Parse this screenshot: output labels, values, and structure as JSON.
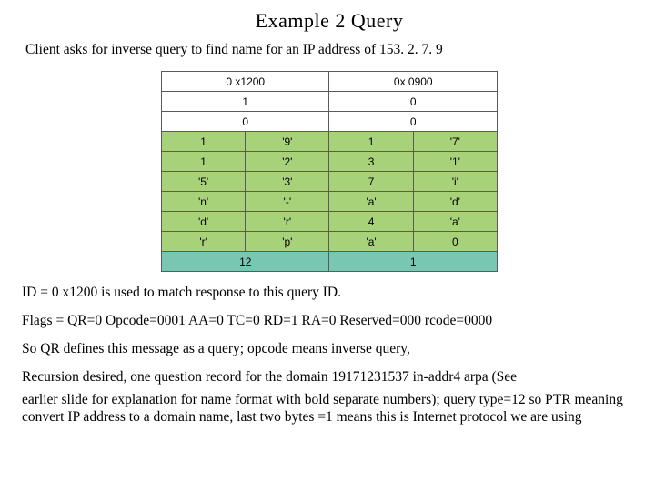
{
  "title": "Example 2 Query",
  "subtitle": "Client asks for inverse query to find name for an IP address of 153. 2. 7. 9",
  "table": {
    "r0": {
      "a": "0 x1200",
      "b": "0x 0900"
    },
    "r1": {
      "a": "1",
      "b": "0"
    },
    "r2": {
      "a": "0",
      "b": "0"
    },
    "r3": {
      "a": "1",
      "b": "'9'",
      "c": "1",
      "d": "'7'"
    },
    "r4": {
      "a": "1",
      "b": "'2'",
      "c": "3",
      "d": "'1'"
    },
    "r5": {
      "a": "'5'",
      "b": "'3'",
      "c": "7",
      "d": "'i'"
    },
    "r6": {
      "a": "'n'",
      "b": "'-'",
      "c": "'a'",
      "d": "'d'"
    },
    "r7": {
      "a": "'d'",
      "b": "'r'",
      "c": "4",
      "d": "'a'"
    },
    "r8": {
      "a": "'r'",
      "b": "'p'",
      "c": "'a'",
      "d": "0"
    },
    "r9": {
      "a": "12",
      "b": "1"
    }
  },
  "para": {
    "p1": "ID = 0 x1200 is used to match response to this query ID.",
    "p2": "Flags = QR=0 Opcode=0001 AA=0 TC=0 RD=1 RA=0 Reserved=000 rcode=0000",
    "p3": "So QR defines this message as a query; opcode means inverse query,",
    "p4": "Recursion desired, one question record for the domain 19171231537 in-addr4 arpa (See",
    "p5": "earlier slide for explanation for name format with bold separate numbers); query type=12 so PTR meaning convert IP address to a domain name, last two bytes =1 means this is Internet protocol we are using"
  }
}
